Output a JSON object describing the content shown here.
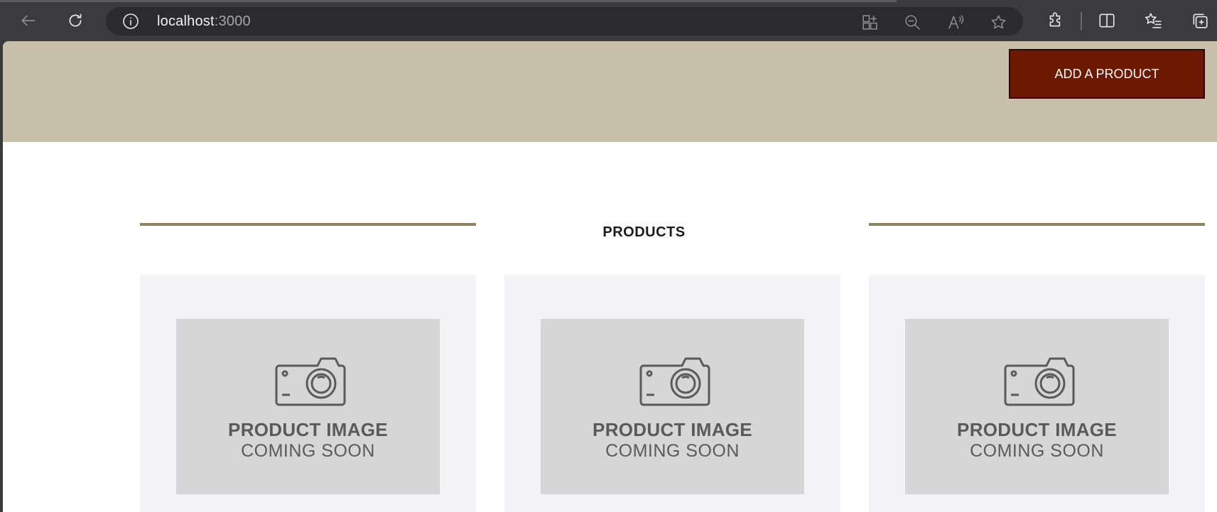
{
  "browser": {
    "url_host": "localhost",
    "url_port": ":3000"
  },
  "header": {
    "add_product_label": "ADD A PRODUCT"
  },
  "section": {
    "title": "PRODUCTS"
  },
  "products": [
    {
      "image_line1": "PRODUCT IMAGE",
      "image_line2": "COMING SOON"
    },
    {
      "image_line1": "PRODUCT IMAGE",
      "image_line2": "COMING SOON"
    },
    {
      "image_line1": "PRODUCT IMAGE",
      "image_line2": "COMING SOON"
    }
  ],
  "icons": {
    "back": "back-arrow-icon",
    "refresh": "refresh-icon",
    "info": "info-icon",
    "app": "app-available-icon",
    "zoom": "zoom-out-icon",
    "read_aloud": "read-aloud-icon",
    "favorite": "star-icon",
    "extensions": "extensions-icon",
    "split": "split-screen-icon",
    "favorites": "favorites-icon",
    "collections": "collections-icon",
    "camera": "camera-icon"
  },
  "colors": {
    "header_bg": "#c7bfa7",
    "button_bg": "#6b1900",
    "section_line": "#8f8462",
    "card_bg": "#f3f3f5",
    "placeholder_bg": "#d6d6d6"
  }
}
